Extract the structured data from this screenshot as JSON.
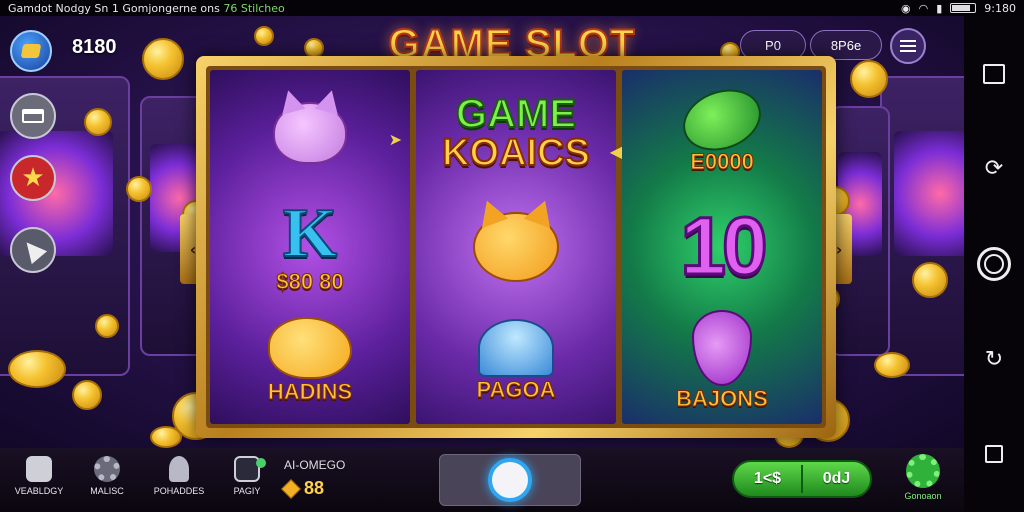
{
  "status_bar": {
    "notification_text": "Gamdot Nodgy Sn 1 Gomjongerne ons",
    "notification_suffix": "76 Stilcheo",
    "time": "9:180"
  },
  "hud": {
    "balance": "8180",
    "title": "GAME SLOT",
    "pill_left": "P0",
    "pill_right": "8P6e"
  },
  "reels": {
    "reel1": {
      "symbol2_letter": "K",
      "symbol2_label": "$80 80",
      "symbol3_label": "HADINS"
    },
    "reel2": {
      "title_line1": "GAME",
      "title_line2": "KOAICS",
      "symbol3_label": "PAGOA"
    },
    "reel3": {
      "symbol1_label": "E0000",
      "symbol2_value": "10",
      "symbol3_label": "BAJONS"
    }
  },
  "bottom_bar": {
    "nav": [
      {
        "label": "VEABLDGY"
      },
      {
        "label": "MALISC"
      },
      {
        "label": "POHADDES"
      },
      {
        "label": "PAGIY"
      }
    ],
    "win_title": "AI-OMEGO",
    "win_value": "88",
    "bet_left": "1<$",
    "bet_right": "0dJ",
    "settings_label": "Gonoaon"
  },
  "colors": {
    "title_gold": "#ffd447",
    "spin_ring": "#2fa6f0",
    "bet_green": "#3fb83a"
  }
}
